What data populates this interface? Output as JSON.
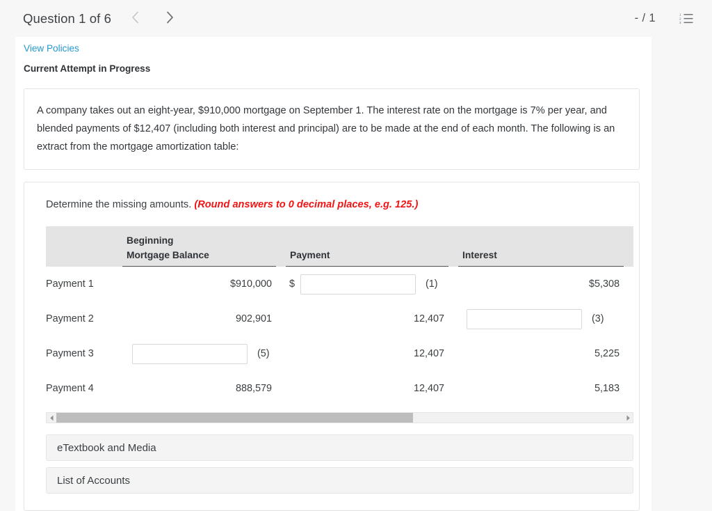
{
  "topbar": {
    "question_label": "Question 1 of 6",
    "prev_icon": "chevron-left-icon",
    "next_icon": "chevron-right-icon",
    "score": "- / 1",
    "list_icon": "numbered-list-icon"
  },
  "header": {
    "view_policies": "View Policies",
    "attempt_status": "Current Attempt in Progress"
  },
  "prompt": {
    "text": "A company takes out an eight-year, $910,000 mortgage on September 1. The interest rate on the mortgage is 7% per year, and blended payments of $12,407 (including both interest and principal) are to be made at the end of each month. The following is an extract from the mortgage amortization table:"
  },
  "instruction": {
    "lead": "Determine the missing amounts.",
    "hint": "(Round answers to 0 decimal places, e.g. 125.)"
  },
  "table": {
    "headers": {
      "blank": "",
      "balance_line1": "Beginning",
      "balance_line2": "Mortgage Balance",
      "payment": "Payment",
      "interest": "Interest"
    },
    "rows": [
      {
        "label": "Payment 1",
        "balance": {
          "type": "text",
          "value": "$910,000"
        },
        "payment": {
          "type": "input",
          "prefix": "$",
          "value": "",
          "marker": "(1)"
        },
        "interest": {
          "type": "text",
          "value": "$5,308"
        }
      },
      {
        "label": "Payment 2",
        "balance": {
          "type": "text",
          "value": "902,901"
        },
        "payment": {
          "type": "text",
          "value": "12,407"
        },
        "interest": {
          "type": "input",
          "prefix": "",
          "value": "",
          "marker": "(3)"
        }
      },
      {
        "label": "Payment 3",
        "balance": {
          "type": "input",
          "prefix": "",
          "value": "",
          "marker": "(5)"
        },
        "payment": {
          "type": "text",
          "value": "12,407"
        },
        "interest": {
          "type": "text",
          "value": "5,225"
        }
      },
      {
        "label": "Payment 4",
        "balance": {
          "type": "text",
          "value": "888,579"
        },
        "payment": {
          "type": "text",
          "value": "12,407"
        },
        "interest": {
          "type": "text",
          "value": "5,183"
        }
      }
    ]
  },
  "scrollbar": {
    "left_arrow_icon": "scroll-left-arrow-icon",
    "right_arrow_icon": "scroll-right-arrow-icon",
    "thumb_percent": 63
  },
  "buttons": {
    "etextbook": "eTextbook and Media",
    "accounts": "List of Accounts"
  },
  "colors": {
    "link": "#2699d2",
    "hint_red": "#f01414",
    "page_bg": "#f7f7f7",
    "table_header_bg": "#e4e4e4"
  }
}
